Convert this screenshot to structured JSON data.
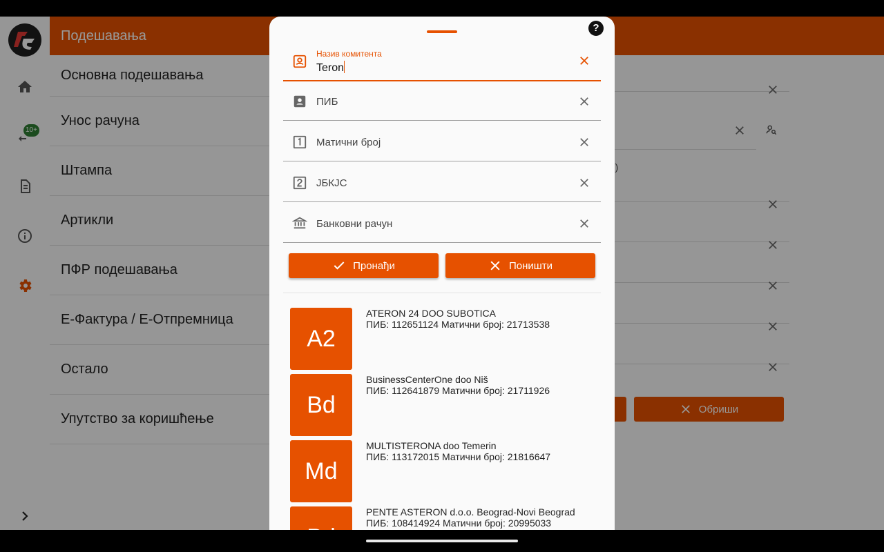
{
  "app_bar": {
    "title": "Подешавања"
  },
  "rail": {
    "badge": "10+"
  },
  "settings_menu": [
    {
      "label": "Основна подешавања"
    },
    {
      "label": "Унос рачуна"
    },
    {
      "label": "Штампа"
    },
    {
      "label": "Артикли"
    },
    {
      "label": "ПФР подешавања"
    },
    {
      "label": "Е-Фактура / Е-Отпремница"
    },
    {
      "label": "Остало"
    },
    {
      "label": "Упутство за коришћење"
    }
  ],
  "background_pane": {
    "fragment": "Ф)",
    "delete_label": "Обриши"
  },
  "search_sheet": {
    "help": "?",
    "fields": {
      "name": {
        "label": "Назив комитента",
        "value": "Teron"
      },
      "pib": {
        "label": "ПИБ"
      },
      "mb": {
        "label": "Матични број"
      },
      "jbkjs": {
        "label": "ЈБКЈС"
      },
      "bank": {
        "label": "Банковни рачун"
      }
    },
    "find_label": "Пронађи",
    "cancel_label": "Поништи",
    "results": [
      {
        "initials": "A2",
        "name": "ATERON 24 DOO SUBOTICA",
        "meta": "ПИБ: 112651124 Матични број: 21713538"
      },
      {
        "initials": "Bd",
        "name": "BusinessCenterOne doo Niš",
        "meta": "ПИБ: 112641879 Матични број: 21711926"
      },
      {
        "initials": "Md",
        "name": "MULTISTERONA doo Temerin",
        "meta": "ПИБ: 113172015 Матични број: 21816647"
      },
      {
        "initials": "Pd",
        "name": "PENTE ASTERON d.o.o. Beograd-Novi Beograd",
        "meta": "ПИБ: 108414924 Матични број: 20995033"
      }
    ]
  },
  "colors": {
    "accent": "#e65100",
    "scrim": "rgba(0,0,0,0.40)"
  }
}
